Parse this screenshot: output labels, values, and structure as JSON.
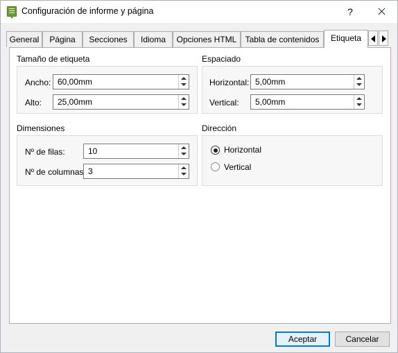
{
  "window": {
    "title": "Configuración de informe y página",
    "help_glyph": "?"
  },
  "tabs": [
    "General",
    "Página",
    "Secciones",
    "Idioma",
    "Opciones HTML",
    "Tabla de contenidos",
    "Etiqueta"
  ],
  "active_tab": "Etiqueta",
  "label_size": {
    "heading": "Tamaño de etiqueta",
    "width": {
      "label": "Ancho:",
      "value": "60,00mm"
    },
    "height": {
      "label": "Alto:",
      "value": "25,00mm"
    }
  },
  "spacing": {
    "heading": "Espaciado",
    "horizontal": {
      "label": "Horizontal:",
      "value": "5,00mm"
    },
    "vertical": {
      "label": "Vertical:",
      "value": "5,00mm"
    }
  },
  "dimensions": {
    "heading": "Dimensiones",
    "rows": {
      "label": "Nº de filas:",
      "value": "10"
    },
    "columns": {
      "label": "Nº de columnas:",
      "value": "3"
    }
  },
  "direction": {
    "heading": "Dirección",
    "options": [
      "Horizontal",
      "Vertical"
    ],
    "selected": "Horizontal"
  },
  "footer": {
    "ok": "Aceptar",
    "cancel": "Cancelar"
  },
  "colors": {
    "accent": "#0078d7",
    "icon": "#6a9a34"
  }
}
